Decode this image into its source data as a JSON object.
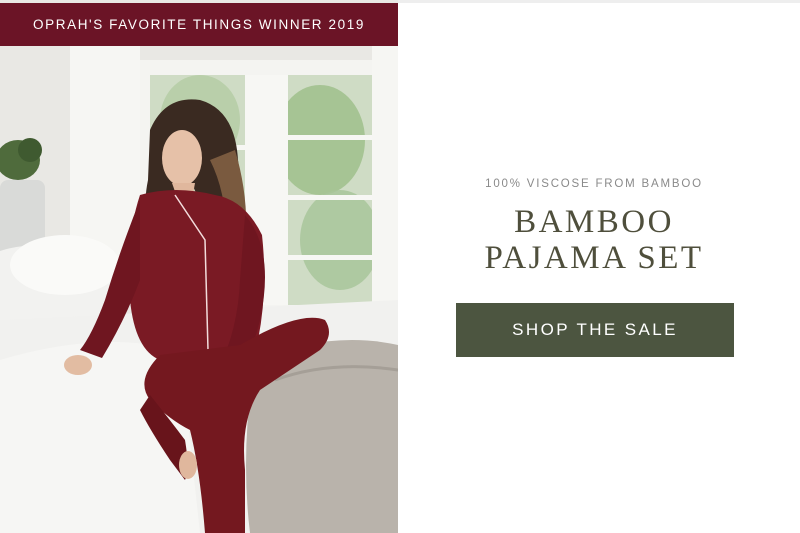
{
  "banner": {
    "text": "OPRAH'S FAVORITE THINGS WINNER 2019"
  },
  "promo": {
    "kicker": "100% VISCOSE FROM BAMBOO",
    "title_line1": "BAMBOO",
    "title_line2": "PAJAMA SET",
    "cta_label": "SHOP THE SALE"
  },
  "colors": {
    "banner_bg": "#6b1426",
    "cta_bg": "#4c5540",
    "title_text": "#4f4f3c",
    "kicker_text": "#8a8a8a",
    "pajama": "#7a1a24"
  },
  "image": {
    "icon": "woman-in-pajamas-photo"
  }
}
